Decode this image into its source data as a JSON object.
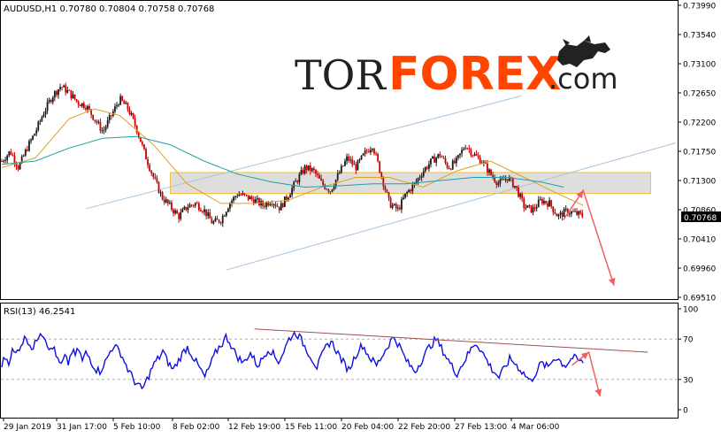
{
  "price_panel": {
    "header": "AUDUSD,H1  0.70780 0.70804 0.70758 0.70768",
    "current_price_label": "0.70768"
  },
  "rsi_panel": {
    "header": "RSI(13) 46.2541"
  },
  "logo": {
    "part1": "TOR",
    "part2": "FOREX",
    "part3": ".com"
  },
  "colors": {
    "bull_candle": "#1a1a1a",
    "bear_candle": "#cc0000",
    "ma_fast": "#e0a020",
    "ma_slow": "#20a0a0",
    "channel": "#a8c4dc",
    "zone_fill": "#d8d8d8",
    "zone_border": "#f0c040",
    "forecast_arrow": "#f06060",
    "rsi_line": "#1010e0",
    "rsi_trend": "#a05050",
    "logo_orange": "#ff4500",
    "logo_dark": "#222222"
  },
  "chart_data": [
    {
      "type": "candlestick",
      "symbol": "AUDUSD",
      "timeframe": "H1",
      "ohlc_last": {
        "open": 0.7078,
        "high": 0.70804,
        "low": 0.70758,
        "close": 0.70768
      },
      "ylim": [
        0.6951,
        0.7399
      ],
      "y_ticks": [
        "0.73990",
        "0.73540",
        "0.73100",
        "0.72650",
        "0.72200",
        "0.71750",
        "0.71300",
        "0.70860",
        "0.70410",
        "0.69960",
        "0.69510"
      ],
      "x_ticks": [
        "29 Jan 2019",
        "31 Jan 17:00",
        "5 Feb 10:00",
        "8 Feb 02:00",
        "12 Feb 19:00",
        "15 Feb 11:00",
        "20 Feb 04:00",
        "22 Feb 20:00",
        "27 Feb 13:00",
        "4 Mar 06:00"
      ],
      "close_path": [
        {
          "t": 0,
          "v": 0.716
        },
        {
          "t": 3,
          "v": 0.7175
        },
        {
          "t": 6,
          "v": 0.715
        },
        {
          "t": 9,
          "v": 0.718
        },
        {
          "t": 12,
          "v": 0.7205
        },
        {
          "t": 15,
          "v": 0.7235
        },
        {
          "t": 18,
          "v": 0.726
        },
        {
          "t": 21,
          "v": 0.7275
        },
        {
          "t": 24,
          "v": 0.7265
        },
        {
          "t": 27,
          "v": 0.725
        },
        {
          "t": 30,
          "v": 0.7245
        },
        {
          "t": 33,
          "v": 0.7225
        },
        {
          "t": 36,
          "v": 0.7205
        },
        {
          "t": 39,
          "v": 0.723
        },
        {
          "t": 42,
          "v": 0.7255
        },
        {
          "t": 45,
          "v": 0.724
        },
        {
          "t": 48,
          "v": 0.721
        },
        {
          "t": 51,
          "v": 0.717
        },
        {
          "t": 54,
          "v": 0.7135
        },
        {
          "t": 57,
          "v": 0.7105
        },
        {
          "t": 60,
          "v": 0.709
        },
        {
          "t": 63,
          "v": 0.7075
        },
        {
          "t": 66,
          "v": 0.709
        },
        {
          "t": 69,
          "v": 0.7095
        },
        {
          "t": 72,
          "v": 0.7085
        },
        {
          "t": 75,
          "v": 0.7065
        },
        {
          "t": 78,
          "v": 0.707
        },
        {
          "t": 81,
          "v": 0.7095
        },
        {
          "t": 84,
          "v": 0.711
        },
        {
          "t": 87,
          "v": 0.7105
        },
        {
          "t": 90,
          "v": 0.71
        },
        {
          "t": 93,
          "v": 0.7092
        },
        {
          "t": 96,
          "v": 0.71
        },
        {
          "t": 99,
          "v": 0.7088
        },
        {
          "t": 102,
          "v": 0.7108
        },
        {
          "t": 105,
          "v": 0.713
        },
        {
          "t": 108,
          "v": 0.715
        },
        {
          "t": 111,
          "v": 0.7145
        },
        {
          "t": 114,
          "v": 0.7125
        },
        {
          "t": 117,
          "v": 0.7115
        },
        {
          "t": 120,
          "v": 0.714
        },
        {
          "t": 123,
          "v": 0.7165
        },
        {
          "t": 126,
          "v": 0.715
        },
        {
          "t": 129,
          "v": 0.717
        },
        {
          "t": 132,
          "v": 0.7185
        },
        {
          "t": 135,
          "v": 0.714
        },
        {
          "t": 138,
          "v": 0.7095
        },
        {
          "t": 141,
          "v": 0.7085
        },
        {
          "t": 144,
          "v": 0.711
        },
        {
          "t": 147,
          "v": 0.7125
        },
        {
          "t": 150,
          "v": 0.7145
        },
        {
          "t": 153,
          "v": 0.716
        },
        {
          "t": 156,
          "v": 0.717
        },
        {
          "t": 159,
          "v": 0.715
        },
        {
          "t": 162,
          "v": 0.716
        },
        {
          "t": 165,
          "v": 0.7185
        },
        {
          "t": 168,
          "v": 0.717
        },
        {
          "t": 171,
          "v": 0.716
        },
        {
          "t": 174,
          "v": 0.714
        },
        {
          "t": 177,
          "v": 0.7125
        },
        {
          "t": 180,
          "v": 0.7135
        },
        {
          "t": 183,
          "v": 0.712
        },
        {
          "t": 186,
          "v": 0.709
        },
        {
          "t": 189,
          "v": 0.7085
        },
        {
          "t": 192,
          "v": 0.71
        },
        {
          "t": 195,
          "v": 0.7095
        },
        {
          "t": 198,
          "v": 0.7075
        },
        {
          "t": 201,
          "v": 0.7083
        },
        {
          "t": 204,
          "v": 0.708
        },
        {
          "t": 207,
          "v": 0.7076
        }
      ],
      "moving_averages": [
        {
          "kind": "fast",
          "points": [
            {
              "t": 0,
              "v": 0.715
            },
            {
              "t": 12,
              "v": 0.7165
            },
            {
              "t": 24,
              "v": 0.7225
            },
            {
              "t": 33,
              "v": 0.724
            },
            {
              "t": 42,
              "v": 0.723
            },
            {
              "t": 54,
              "v": 0.7185
            },
            {
              "t": 66,
              "v": 0.7125
            },
            {
              "t": 78,
              "v": 0.7095
            },
            {
              "t": 90,
              "v": 0.7095
            },
            {
              "t": 102,
              "v": 0.71
            },
            {
              "t": 114,
              "v": 0.712
            },
            {
              "t": 126,
              "v": 0.7135
            },
            {
              "t": 138,
              "v": 0.7135
            },
            {
              "t": 150,
              "v": 0.712
            },
            {
              "t": 162,
              "v": 0.7145
            },
            {
              "t": 174,
              "v": 0.716
            },
            {
              "t": 186,
              "v": 0.7135
            },
            {
              "t": 198,
              "v": 0.711
            },
            {
              "t": 207,
              "v": 0.7092
            }
          ]
        },
        {
          "kind": "slow",
          "points": [
            {
              "t": 0,
              "v": 0.7155
            },
            {
              "t": 12,
              "v": 0.716
            },
            {
              "t": 24,
              "v": 0.718
            },
            {
              "t": 36,
              "v": 0.7195
            },
            {
              "t": 48,
              "v": 0.7198
            },
            {
              "t": 60,
              "v": 0.7185
            },
            {
              "t": 72,
              "v": 0.716
            },
            {
              "t": 84,
              "v": 0.714
            },
            {
              "t": 96,
              "v": 0.7128
            },
            {
              "t": 108,
              "v": 0.712
            },
            {
              "t": 120,
              "v": 0.7122
            },
            {
              "t": 132,
              "v": 0.7125
            },
            {
              "t": 144,
              "v": 0.7125
            },
            {
              "t": 156,
              "v": 0.713
            },
            {
              "t": 168,
              "v": 0.7135
            },
            {
              "t": 180,
              "v": 0.7135
            },
            {
              "t": 192,
              "v": 0.7128
            },
            {
              "t": 200,
              "v": 0.712
            }
          ]
        }
      ],
      "channel_lines": [
        {
          "from": {
            "t": 30,
            "v": 0.7087
          },
          "to": {
            "t": 185,
            "v": 0.726
          }
        },
        {
          "from": {
            "t": 80,
            "v": 0.6993
          },
          "to": {
            "t": 240,
            "v": 0.7188
          }
        }
      ],
      "resistance_zone": {
        "t_from": 60,
        "t_to": 231,
        "v_low": 0.71105,
        "v_high": 0.71425
      },
      "forecast_path": [
        {
          "t": 200,
          "v": 0.707
        },
        {
          "t": 207,
          "v": 0.7115
        },
        {
          "t": 218,
          "v": 0.6969
        }
      ]
    },
    {
      "type": "line",
      "indicator": "RSI(13)",
      "value_last": 46.2541,
      "ylim": [
        0,
        100
      ],
      "y_ticks": [
        "100",
        "70",
        "30",
        "0"
      ],
      "levels": [
        70,
        30
      ],
      "series": [
        {
          "values": [
            45,
            52,
            48,
            58,
            55,
            62,
            68,
            72,
            65,
            60,
            70,
            78,
            74,
            66,
            58,
            62,
            48,
            44,
            52,
            46,
            58,
            54,
            60,
            48,
            56,
            52,
            45,
            40,
            38,
            44,
            50,
            58,
            64,
            60,
            56,
            48,
            40,
            34,
            28,
            24,
            20,
            26,
            34,
            42,
            48,
            52,
            58,
            50,
            44,
            40,
            46,
            52,
            58,
            62,
            56,
            50,
            44,
            38,
            32,
            40,
            48,
            56,
            62,
            66,
            72,
            68,
            60,
            54,
            50,
            46,
            52,
            56,
            50,
            44,
            48,
            54,
            60,
            58,
            52,
            48,
            54,
            62,
            70,
            74,
            76,
            72,
            66,
            60,
            54,
            48,
            42,
            50,
            58,
            64,
            68,
            62,
            56,
            50,
            44,
            40,
            46,
            54,
            60,
            64,
            58,
            52,
            48,
            44,
            50,
            56,
            62,
            68,
            72,
            66,
            60,
            52,
            46,
            42,
            38,
            44,
            50,
            56,
            62,
            66,
            70,
            64,
            58,
            52,
            46,
            40,
            36,
            42,
            48,
            54,
            60,
            66,
            64,
            58,
            52,
            46,
            40,
            36,
            32,
            38,
            44,
            50,
            48,
            44,
            40,
            36,
            32,
            28,
            34,
            40,
            46,
            44,
            42,
            48,
            52,
            50,
            46,
            44,
            48,
            52,
            50,
            48,
            46
          ]
        }
      ],
      "trendline": {
        "from": {
          "t": 90,
          "v": 80
        },
        "to": {
          "t": 230,
          "v": 57
        }
      },
      "forecast_path": [
        {
          "t": 203,
          "v": 44
        },
        {
          "t": 209,
          "v": 57
        },
        {
          "t": 213,
          "v": 13
        }
      ]
    }
  ]
}
